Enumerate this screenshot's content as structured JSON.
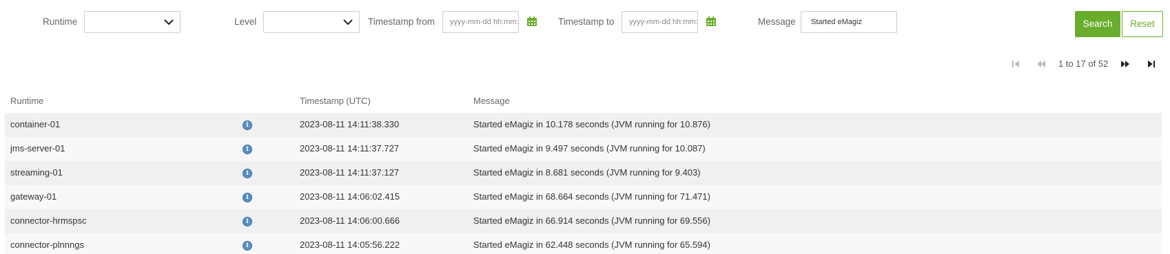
{
  "filters": {
    "runtime_label": "Runtime",
    "runtime_value": "",
    "level_label": "Level",
    "level_value": "",
    "timestamp_from_label": "Timestamp from",
    "timestamp_from_placeholder": "yyyy-mm-dd hh:mm:ss",
    "timestamp_to_label": "Timestamp to",
    "timestamp_to_placeholder": "yyyy-mm-dd hh:mm:ss",
    "message_label": "Message",
    "message_value": "Started eMagiz",
    "search_label": "Search",
    "reset_label": "Reset"
  },
  "pager": {
    "text": "1 to 17 of 52"
  },
  "table": {
    "headers": {
      "runtime": "Runtime",
      "timestamp": "Timestamp (UTC)",
      "message": "Message"
    },
    "rows": [
      {
        "runtime": "container-01",
        "level_icon": "info-icon",
        "timestamp": "2023-08-11 14:11:38.330",
        "message": "Started eMagiz in 10.178 seconds (JVM running for 10.876)"
      },
      {
        "runtime": "jms-server-01",
        "level_icon": "info-icon",
        "timestamp": "2023-08-11 14:11:37.727",
        "message": "Started eMagiz in 9.497 seconds (JVM running for 10.087)"
      },
      {
        "runtime": "streaming-01",
        "level_icon": "info-icon",
        "timestamp": "2023-08-11 14:11:37.127",
        "message": "Started eMagiz in 8.681 seconds (JVM running for 9.403)"
      },
      {
        "runtime": "gateway-01",
        "level_icon": "info-icon",
        "timestamp": "2023-08-11 14:06:02.415",
        "message": "Started eMagiz in 68.664 seconds (JVM running for 71.471)"
      },
      {
        "runtime": "connector-hrmspsc",
        "level_icon": "info-icon",
        "timestamp": "2023-08-11 14:06:00.666",
        "message": "Started eMagiz in 66.914 seconds (JVM running for 69.556)"
      },
      {
        "runtime": "connector-plnnngs",
        "level_icon": "info-icon",
        "timestamp": "2023-08-11 14:05:56.222",
        "message": "Started eMagiz in 62.448 seconds (JVM running for 65.594)"
      }
    ]
  },
  "colors": {
    "accent_green": "#6aad2d",
    "info_blue": "#5a8ec6"
  }
}
